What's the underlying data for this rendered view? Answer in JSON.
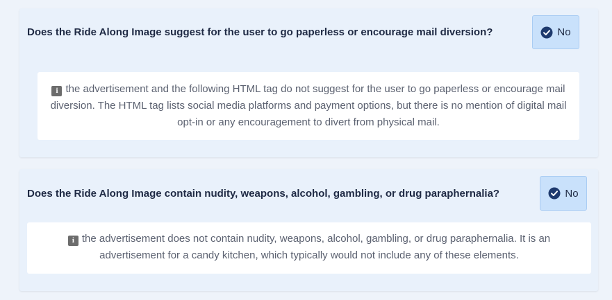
{
  "items": [
    {
      "question": "Does the Ride Along Image suggest for the user to go paperless or encourage mail diversion?",
      "answer": "No",
      "explanation": "the advertisement and the following HTML tag do not suggest for the user to go paperless or encourage mail diversion. The HTML tag lists social media platforms and payment options, but there is no mention of digital mail opt-in or any encouragement to divert from physical mail."
    },
    {
      "question": "Does the Ride Along Image contain nudity, weapons, alcohol, gambling, or drug paraphernalia?",
      "answer": "No",
      "explanation": "the advertisement does not contain nudity, weapons, alcohol, gambling, or drug paraphernalia. It is an advertisement for a candy kitchen, which typically would not include any of these elements."
    }
  ],
  "icons": {
    "answer": "check-circle-icon",
    "explanation": "info-icon"
  },
  "colors": {
    "accent": "#1e3a6e",
    "answer_bg": "#c9e1fb"
  }
}
